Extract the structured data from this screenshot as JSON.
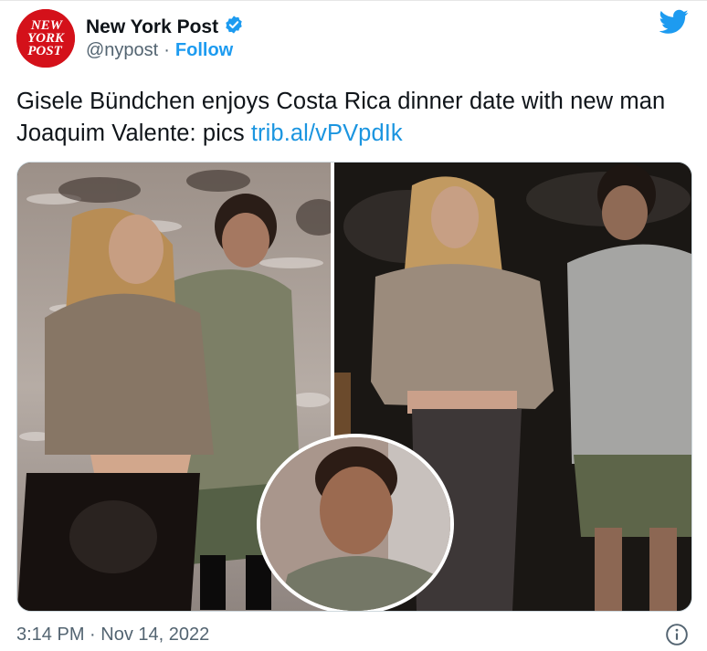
{
  "account": {
    "display_name": "New York Post",
    "handle": "@nypost",
    "separator": "·",
    "follow_label": "Follow",
    "avatar_text": [
      "NEW",
      "YORK",
      "POST"
    ],
    "verified": true
  },
  "tweet": {
    "text_prefix": "Gisele Bündchen enjoys Costa Rica dinner date with new man Joaquim Valente: pics ",
    "link_text": "trib.al/vPVpdIk"
  },
  "media": {
    "photo_count": 2,
    "has_inset_photo": true
  },
  "footer": {
    "timestamp": "3:14 PM · Nov 14, 2022"
  },
  "icons": {
    "brand": "twitter-bird-icon",
    "verified": "verified-badge-icon",
    "info": "info-icon"
  },
  "colors": {
    "link": "#1b95e0",
    "follow": "#1d9bf0",
    "avatar_bg": "#d4111a",
    "muted_text": "#536471"
  }
}
